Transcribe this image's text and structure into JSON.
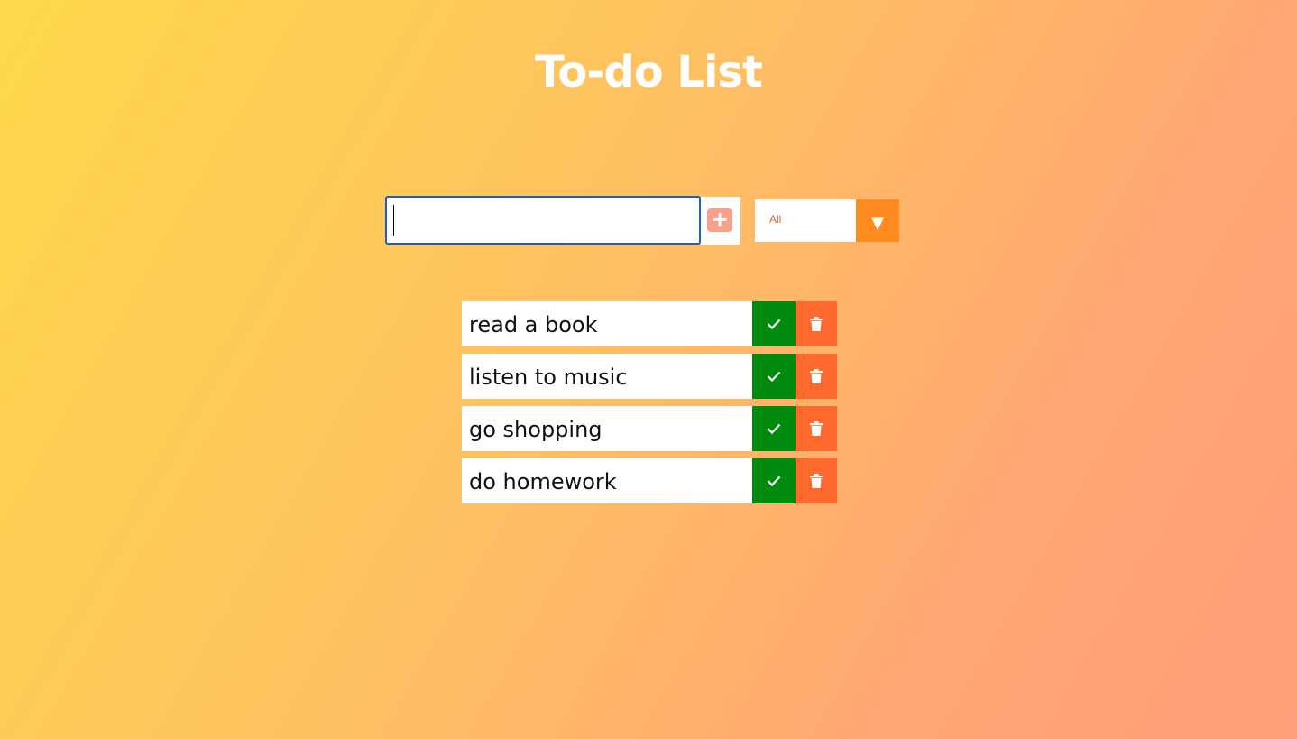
{
  "header": {
    "title": "To-do List"
  },
  "form": {
    "input_value": "",
    "input_placeholder": "",
    "add_icon": "plus-icon",
    "filter": {
      "selected": "All",
      "options": [
        "All"
      ]
    }
  },
  "todos": [
    {
      "text": "read a book"
    },
    {
      "text": "listen to music"
    },
    {
      "text": "go shopping"
    },
    {
      "text": "do homework"
    }
  ],
  "colors": {
    "complete_button": "#008a0e",
    "delete_button": "#ff6a2c",
    "filter_arrow": "#ff8a1f",
    "add_button": "#f7a18a"
  }
}
